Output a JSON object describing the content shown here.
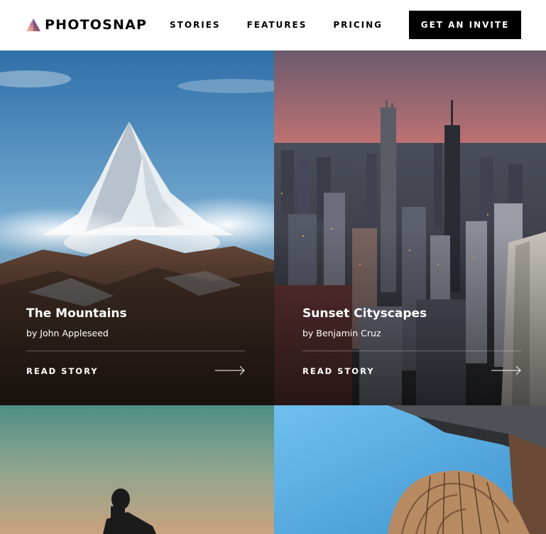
{
  "brand": {
    "name": "PHOTOSNAP"
  },
  "nav": {
    "items": [
      "STORIES",
      "FEATURES",
      "PRICING"
    ]
  },
  "cta": {
    "label": "GET AN INVITE"
  },
  "stories": [
    {
      "title": "The Mountains",
      "author": "by John Appleseed",
      "link": "READ STORY"
    },
    {
      "title": "Sunset Cityscapes",
      "author": "by Benjamin Cruz",
      "link": "READ STORY"
    }
  ],
  "icons": {
    "logo": "photosnap-logo-icon",
    "arrow": "arrow-right-icon"
  }
}
